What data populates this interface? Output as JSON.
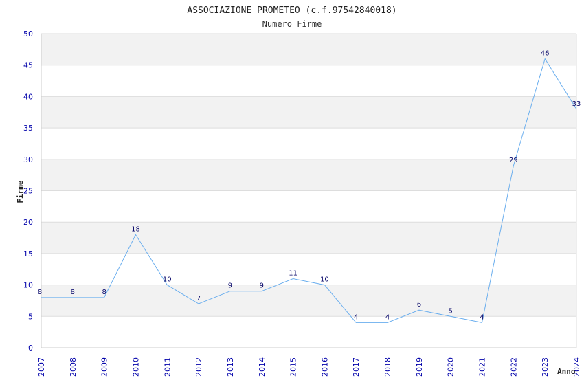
{
  "chart_data": {
    "type": "line",
    "title": "ASSOCIAZIONE PROMETEO (c.f.97542840018)",
    "subtitle": "Numero Firme",
    "xlabel": "Anno",
    "ylabel": "Firme",
    "ylim": [
      0,
      50
    ],
    "yticks": [
      0,
      5,
      10,
      15,
      20,
      25,
      30,
      35,
      40,
      45,
      50
    ],
    "categories": [
      "2007",
      "2008",
      "2009",
      "2010",
      "2011",
      "2012",
      "2013",
      "2014",
      "2015",
      "2016",
      "2017",
      "2018",
      "2019",
      "2020",
      "2021",
      "2022",
      "2023",
      "2024"
    ],
    "series": [
      {
        "values": [
          8,
          8,
          8,
          18,
          10,
          7,
          9,
          9,
          11,
          10,
          4,
          4,
          6,
          5,
          4,
          29,
          46,
          38
        ]
      }
    ],
    "data_labels": [
      "8",
      "8",
      "8",
      "18",
      "10",
      "7",
      "9",
      "9",
      "11",
      "10",
      "4",
      "4",
      "6",
      "5",
      "4",
      "29",
      "46",
      "33"
    ],
    "grid": true,
    "colors": {
      "line": "#6aaeee",
      "band": "#f2f2f2",
      "gridline": "#dddddd",
      "tick_text": "#0000aa",
      "label_text": "#000066"
    }
  }
}
